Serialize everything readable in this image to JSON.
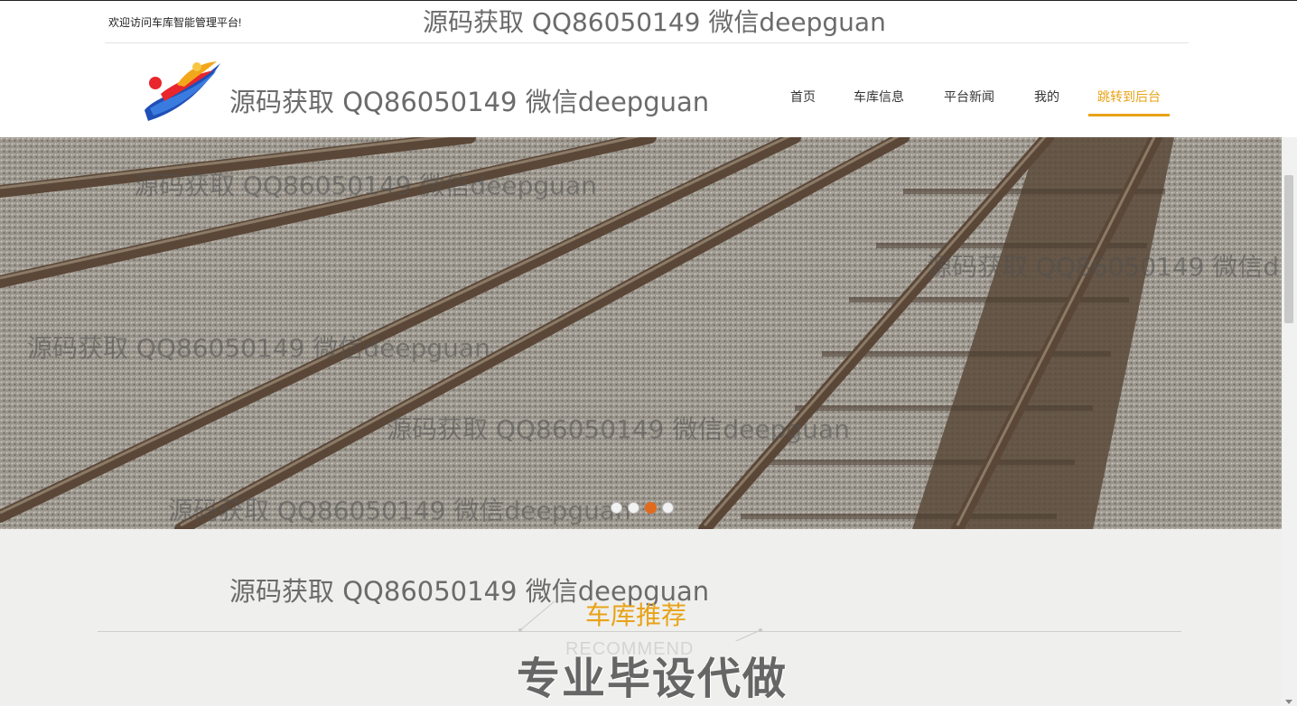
{
  "header": {
    "welcome_text": "欢迎访问车库智能管理平台!",
    "watermark_top": "源码获取 QQ86050149 微信deepguan",
    "watermark_header": "源码获取 QQ86050149 微信deepguan"
  },
  "logo": {
    "icon": "runner-logo-icon"
  },
  "nav": {
    "items": [
      {
        "label": "首页",
        "active": false
      },
      {
        "label": "车库信息",
        "active": false
      },
      {
        "label": "平台新闻",
        "active": false
      },
      {
        "label": "我的",
        "active": false
      },
      {
        "label": "跳转到后台",
        "active": true
      }
    ]
  },
  "banner": {
    "watermarks": [
      "源码获取 QQ86050149 微信deepguan",
      "源码获取 QQ86050149 微信d",
      "源码获取 QQ86050149 微信deepguan",
      "源码获取 QQ86050149 微信deepguan",
      "源码获取 QQ86050149 微信deepguan"
    ],
    "slide_count": 4,
    "active_slide": 2
  },
  "recommend": {
    "watermark": "源码获取 QQ86050149 微信deepguan",
    "title": "车库推荐",
    "subtitle": "RECOMMEND",
    "overlay": "专业毕设代做"
  },
  "colors": {
    "accent": "#e8a317",
    "section_bg": "#efefed",
    "active_dot": "#e26a1c"
  }
}
